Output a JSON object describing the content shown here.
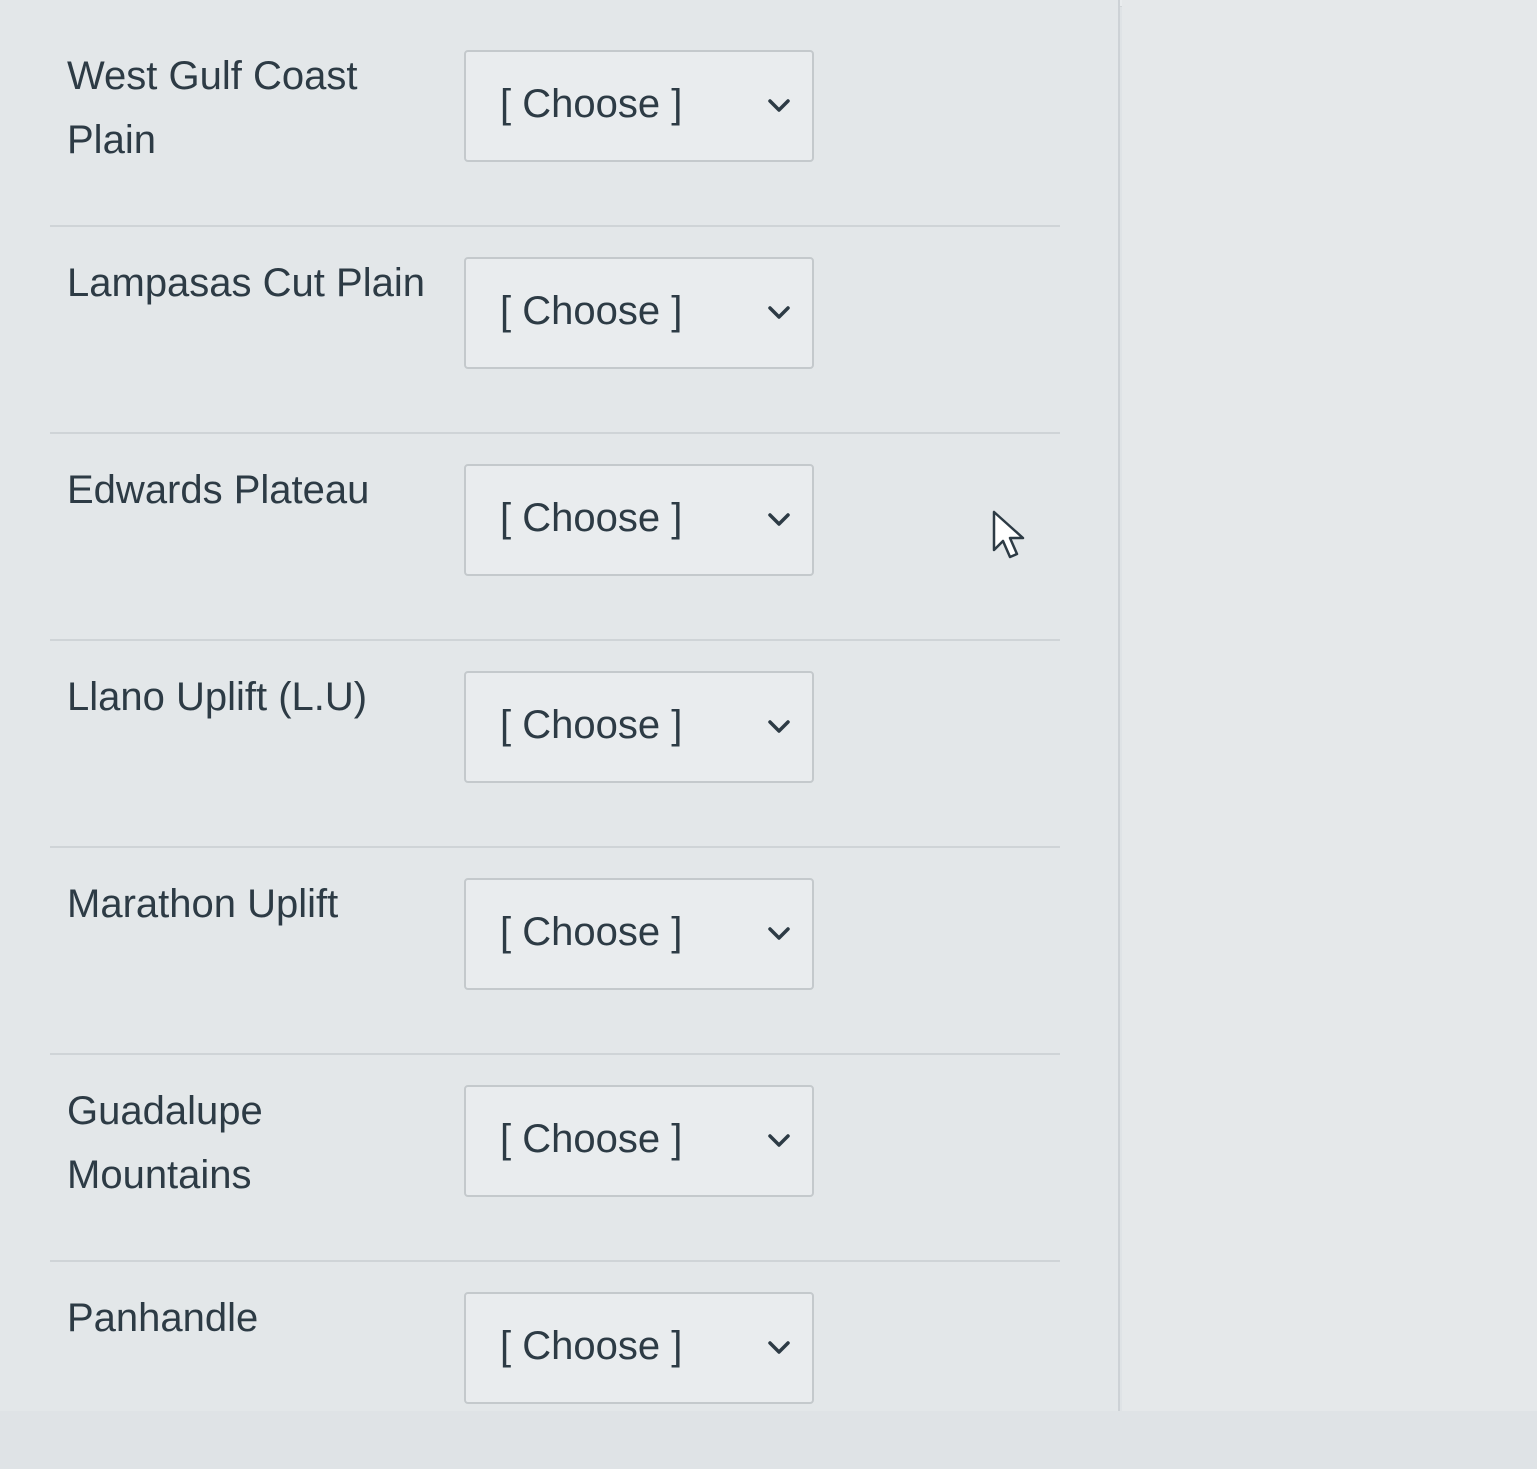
{
  "rows": [
    {
      "label": "West Gulf Coast Plain",
      "select_value": "[ Choose ]"
    },
    {
      "label": "Lampasas Cut Plain",
      "select_value": "[ Choose ]"
    },
    {
      "label": "Edwards Plateau",
      "select_value": "[ Choose ]"
    },
    {
      "label": "Llano Uplift (L.U)",
      "select_value": "[ Choose ]"
    },
    {
      "label": "Marathon Uplift",
      "select_value": "[ Choose ]"
    },
    {
      "label": "Guadalupe Mountains",
      "select_value": "[ Choose ]"
    },
    {
      "label": "Panhandle",
      "select_value": "[ Choose ]"
    }
  ],
  "icons": {
    "select_chevron": "chevron-down-icon",
    "mouse_pointer": "mouse-pointer-icon"
  },
  "colors": {
    "text": "#2d3b45",
    "select_border": "#c4c9cc",
    "divider": "#cfd4d7"
  }
}
